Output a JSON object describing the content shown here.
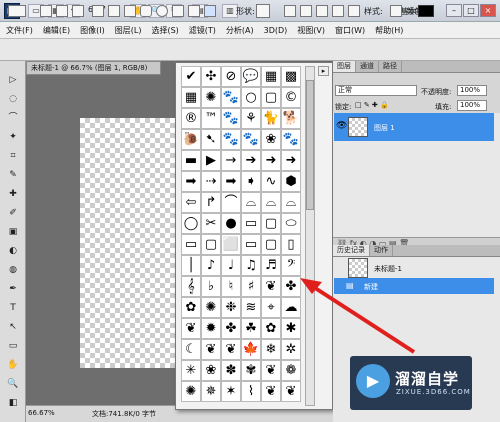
{
  "titlebar": {
    "logo": "Ps",
    "zoom": "66.7",
    "workspace": "基本功能",
    "buttons": [
      "▭",
      "▦",
      "▾",
      "✋",
      "🔍",
      "↻",
      "▤",
      "▥"
    ],
    "win_min": "–",
    "win_max": "□",
    "win_close": "×"
  },
  "menus": [
    "文件(F)",
    "编辑(E)",
    "图像(I)",
    "图层(L)",
    "选择(S)",
    "滤镜(T)",
    "分析(A)",
    "3D(D)",
    "视图(V)",
    "窗口(W)",
    "帮助(H)"
  ],
  "options": {
    "shape_label": "形状:",
    "style_label": "样式:",
    "color_label": "颜色:",
    "color_value": "#000000"
  },
  "tools": [
    "▷",
    "◌",
    "⌒",
    "✦",
    "⌗",
    "✎",
    "✚",
    "✐",
    "▣",
    "◐",
    "◍",
    "✒",
    "T",
    "↖",
    "▭",
    "✋",
    "🔍",
    "◧"
  ],
  "document": {
    "tab": "未标题-1 @ 66.7% (图层 1, RGB/8)",
    "status_zoom": "66.67%",
    "status_doc": "文档:741.8K/0 字节"
  },
  "shapes": [
    "✔",
    "✣",
    "⊘",
    "💬",
    "▦",
    "▩",
    "▦",
    "✺",
    "🐾",
    "○",
    "▢",
    "©",
    "®",
    "™",
    "🐾",
    "⚘",
    "🐈",
    "🐕",
    "🐌",
    "➷",
    "🐾",
    "🐾",
    "❀",
    "🐾",
    "▬",
    "▶",
    "→",
    "➔",
    "➜",
    "➜",
    "➡",
    "⇢",
    "➡",
    "➧",
    "∿",
    "⬢",
    "⇦",
    "↱",
    "⌒",
    "⌓",
    "⌓",
    "⌓",
    "◯",
    "✂",
    "●",
    "▭",
    "▢",
    "⬭",
    "▭",
    "▢",
    "⬜",
    "▭",
    "▢",
    "▯",
    "│",
    "♪",
    "♩",
    "♫",
    "♬",
    "𝄢",
    "𝄞",
    "♭",
    "♮",
    "♯",
    "❦",
    "✤",
    "✿",
    "✺",
    "❉",
    "≋",
    "⌖",
    "☁",
    "❦",
    "✹",
    "✤",
    "☘",
    "✿",
    "✱",
    "☾",
    "❦",
    "❦",
    "🍁",
    "❄",
    "✲",
    "✳",
    "❀",
    "✽",
    "✾",
    "❦",
    "❁",
    "✺",
    "✵",
    "✶",
    "⌇",
    "❦",
    "❦"
  ],
  "layers_panel": {
    "tabs": [
      "图层",
      "通道",
      "路径"
    ],
    "blend_mode": "正常",
    "opacity_label": "不透明度:",
    "opacity_value": "100%",
    "lock_label": "锁定:",
    "fill_label": "填充:",
    "fill_value": "100%",
    "layer_name": "图层 1"
  },
  "history_panel": {
    "tabs": [
      "历史记录",
      "动作"
    ],
    "items": [
      "未标题-1",
      "新建"
    ]
  },
  "watermark": {
    "logo": "▶",
    "name": "溜溜自学",
    "url": "ZIXUE.3D66.COM"
  },
  "colors": {
    "selection": "#3d8ee8",
    "arrow": "#e0201c"
  }
}
